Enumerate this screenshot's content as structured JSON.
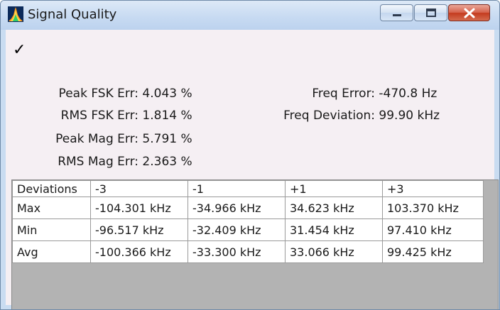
{
  "window": {
    "title": "Signal Quality"
  },
  "status_check": "✓",
  "stats_left": [
    {
      "label": "Peak FSK Err:",
      "value": "4.043 %"
    },
    {
      "label": "RMS FSK Err:",
      "value": "1.814 %"
    },
    {
      "label": "Peak Mag Err:",
      "value": "5.791 %"
    },
    {
      "label": "RMS Mag Err:",
      "value": "2.363 %"
    }
  ],
  "stats_right": [
    {
      "label": "Freq Error:",
      "value": "-470.8 Hz"
    },
    {
      "label": "Freq Deviation:",
      "value": "99.90 kHz"
    }
  ],
  "table": {
    "headers": [
      "Deviations",
      "-3",
      "-1",
      "+1",
      "+3"
    ],
    "rows": [
      {
        "label": "Max",
        "values": [
          "-104.301 kHz",
          "-34.966 kHz",
          "34.623 kHz",
          "103.370 kHz"
        ]
      },
      {
        "label": "Min",
        "values": [
          "-96.517 kHz",
          "-32.409 kHz",
          "31.454 kHz",
          "97.410 kHz"
        ]
      },
      {
        "label": "Avg",
        "values": [
          "-100.366 kHz",
          "-33.300 kHz",
          "33.066 kHz",
          "99.425 kHz"
        ]
      }
    ]
  },
  "colors": {
    "client_background": "#f5eff3",
    "close_button": "#c43b1f",
    "frame": "#c9dcf1"
  },
  "icons": [
    "app-spectrum-icon",
    "minimize-icon",
    "maximize-icon",
    "close-icon",
    "checkmark-icon"
  ]
}
